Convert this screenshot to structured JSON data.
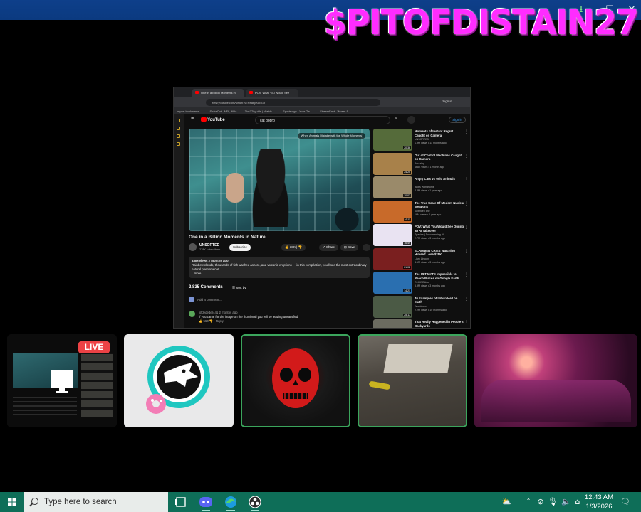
{
  "overlay": {
    "title": "$PITOFDISTAIN27"
  },
  "browser": {
    "tabs": [
      "One in a Billion Moments in",
      "POV: What You Would See"
    ],
    "url": "www.youtube.com/watch?v=ReabpX8EGb",
    "signin": "Sign in",
    "bookmarks": [
      "Import bookmarks...",
      "StrikeOut - NFL, NBA",
      "The778guide | Watch ...",
      "Sportsurge - Your Ga...",
      "StreamEast - Where S..."
    ]
  },
  "youtube": {
    "logo": "YouTube",
    "search_query": "cat gopro",
    "signin": "Sign in",
    "player_hint": "When Animals Mistake with the Whole Moments",
    "video_title": "One in a Billion Moments in Nature",
    "channel": "UNSORTED",
    "subscribers": "278K subscribers",
    "subscribe": "Subscribe",
    "likes": "38K",
    "share": "Share",
    "save": "Save",
    "desc_meta": "5.5M views  2 months ago",
    "desc_text": "Rainbow clouds, thousands of fish washed ashore, and volcanic eruptions — in this compilation, you'll see the most extraordinary natural phenomena!",
    "desc_more": "...more",
    "comments_count": "2,835 Comments",
    "sort_by": "Sort by",
    "add_comment": "Add a comment...",
    "comment_author": "@dededer441  2 months ago",
    "comment_text": "If you came for the image on the thumbnail you will be leaving unsatisfied",
    "comment_likes": "560",
    "comment_reply": "Reply",
    "recommendations": [
      {
        "title": "Moments of Instant Regret Caught on Camera",
        "channel": "UNSORTED",
        "views": "1.9M views • 11 months ago",
        "duration": "20:36",
        "color": "#556b3a"
      },
      {
        "title": "Out of Control Machines Caught on Camera",
        "channel": "Amazing",
        "views": "668K views • 1 month ago",
        "duration": "24:25",
        "color": "#a8814a"
      },
      {
        "title": "Angry Cats vs Wild Animals",
        "channel": "Bikes Worldsome",
        "views": "4.3M views • 1 year ago",
        "duration": "10:02",
        "color": "#9a8a6a"
      },
      {
        "title": "The True Scale Of Modern Nuclear Weapons",
        "channel": "Science Time",
        "views": "16M views • 1 year ago",
        "duration": "16:11",
        "color": "#c86a2a"
      },
      {
        "title": "POV: What You Would See During an AI Takeover",
        "channel": "Spacies | Documenting AI",
        "views": "2.7M views • 3 months ago",
        "duration": "16:49",
        "color": "#e9e3f2"
      },
      {
        "title": "SCAMMER CRIES Watching Himself Lose $25K",
        "channel": "Liam Lincoln",
        "views": "4.1M views • 3 months ago",
        "duration": "21:02",
        "color": "#7a1f1f"
      },
      {
        "title": "The ULTIMATE Impossible to Reach Places on Google Earth",
        "channel": "ReMINDUnzi",
        "views": "5.9M views • 3 months ago",
        "duration": "14:21",
        "color": "#2a6fb0"
      },
      {
        "title": "40 Examples of Urban Hell on Earth",
        "channel": "Worldzone",
        "views": "2.2M views • 10 months ago",
        "duration": "25:17",
        "color": "#4b5a45"
      },
      {
        "title": "That Really Happened in People's Backyards",
        "channel": "",
        "views": "",
        "duration": "",
        "color": "#6b6b60"
      }
    ]
  },
  "participants": {
    "live_badge": "LIVE"
  },
  "taskbar": {
    "search_placeholder": "Type here to search",
    "time": "12:43 AM",
    "date": "1/3/2026"
  }
}
